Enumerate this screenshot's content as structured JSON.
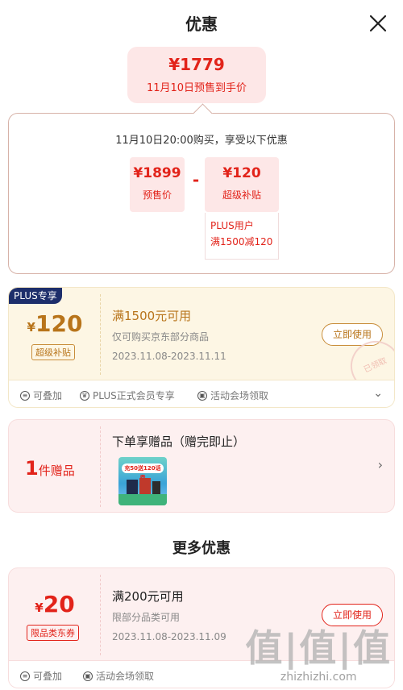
{
  "header": {
    "title": "优惠",
    "close_icon": "close-icon"
  },
  "presale": {
    "amount": "¥1779",
    "label": "11月10日预售到手价"
  },
  "calc": {
    "headline": "11月10日20:00购买，享受以下优惠",
    "presale_price": {
      "value": "¥1899",
      "label": "预售价"
    },
    "minus": "-",
    "subsidy": {
      "value": "¥120",
      "label": "超级补贴"
    },
    "plus_note_line1": "PLUS用户",
    "plus_note_line2": "满1500减120"
  },
  "coupon1": {
    "tag": "PLUS专享",
    "currency": "¥",
    "amount": "120",
    "type_tag": "超级补贴",
    "title": "满1500元可用",
    "desc": "仅可购买京东部分商品",
    "period": "2023.11.08-2023.11.11",
    "button": "立即使用",
    "stamp": "已领取",
    "meta": [
      "可叠加",
      "PLUS正式会员专享",
      "活动会场领取"
    ]
  },
  "gift": {
    "count": "1",
    "count_unit": "件赠品",
    "title": "下单享赠品（赠完即止）",
    "image_badge": "充50送120话费"
  },
  "more": {
    "title": "更多优惠"
  },
  "coupon3": {
    "currency": "¥",
    "amount": "20",
    "type_tag": "限品类东券",
    "title": "满200元可用",
    "desc": "限部分品类可用",
    "period": "2023.11.08-2023.11.09",
    "button": "立即使用",
    "meta": [
      "可叠加",
      "活动会场领取"
    ]
  },
  "watermark": {
    "main": "值|值|值",
    "sub": "zhizhizhi.com"
  },
  "colors": {
    "accent_red": "#e2231a",
    "gold": "#b8741a",
    "plus_navy": "#1d2e6b"
  }
}
